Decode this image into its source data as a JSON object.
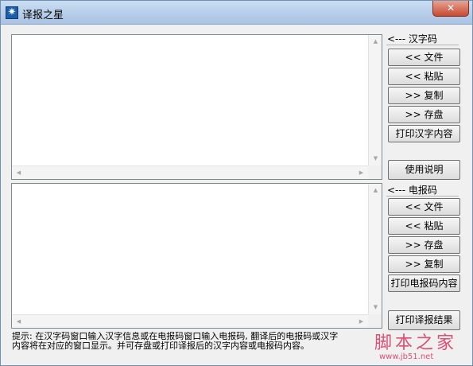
{
  "window": {
    "title": "译报之星",
    "close_label": "✕"
  },
  "chinese_panel": {
    "header": "<--- 汉字码",
    "buttons": [
      "<< 文件",
      "<< 粘贴",
      ">> 复制",
      ">> 存盘",
      "打印汉字内容"
    ]
  },
  "manual_button": "使用说明",
  "telegraph_panel": {
    "header": "<--- 电报码",
    "buttons": [
      "<<  文件",
      "<< 粘贴",
      ">> 存盘",
      ">> 复制",
      "打印电报码内容"
    ]
  },
  "print_result_button": "打印译报结果",
  "hint": {
    "line1": "提示: 在汉字码窗口输入汉字信息或在电报码窗口输入电报码, 翻译后的电报码或汉字",
    "line2": "内容将在对应的窗口显示。并可存盘或打印译报后的汉字内容或电报码内容。"
  },
  "watermark": {
    "text": "脚本之家",
    "url": "www.jb51.net"
  },
  "icons": {
    "app": "app-star-icon",
    "scroll_up": "▲",
    "scroll_down": "▼",
    "scroll_left": "◀",
    "scroll_right": "▶"
  }
}
